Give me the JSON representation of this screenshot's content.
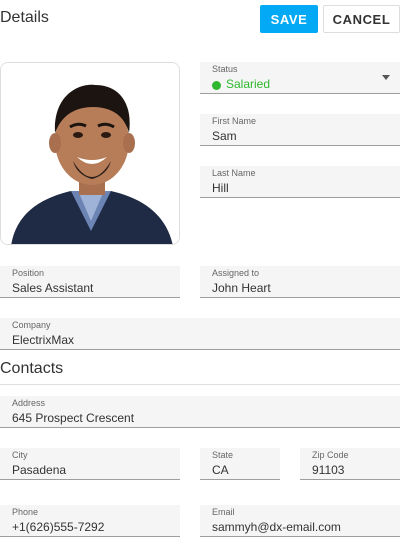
{
  "header": {
    "title": "Details",
    "save_label": "SAVE",
    "cancel_label": "CANCEL"
  },
  "status": {
    "label": "Status",
    "value": "Salaried",
    "color": "#2eb82e"
  },
  "first_name": {
    "label": "First Name",
    "value": "Sam"
  },
  "last_name": {
    "label": "Last Name",
    "value": "Hill"
  },
  "position": {
    "label": "Position",
    "value": "Sales Assistant"
  },
  "assigned_to": {
    "label": "Assigned to",
    "value": "John Heart"
  },
  "company": {
    "label": "Company",
    "value": "ElectrixMax"
  },
  "contacts": {
    "title": "Contacts"
  },
  "address": {
    "label": "Address",
    "value": "645 Prospect Crescent"
  },
  "city": {
    "label": "City",
    "value": "Pasadena"
  },
  "state": {
    "label": "State",
    "value": "CA"
  },
  "zip": {
    "label": "Zip Code",
    "value": "91103"
  },
  "phone": {
    "label": "Phone",
    "value": "+1(626)555-7292"
  },
  "email": {
    "label": "Email",
    "value": "sammyh@dx-email.com"
  },
  "colors": {
    "accent": "#03a9f4"
  }
}
